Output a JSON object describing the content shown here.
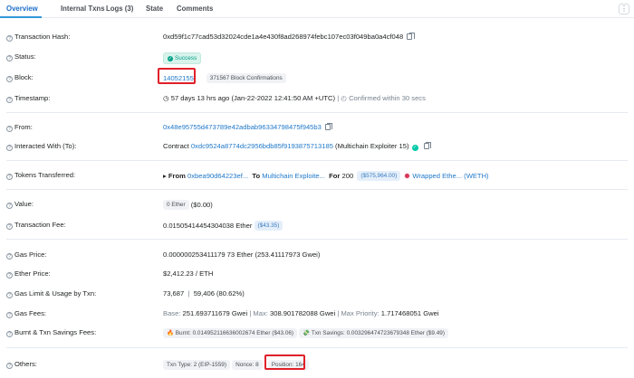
{
  "tabs": [
    "Overview",
    "Internal Txns",
    "Logs (3)",
    "State",
    "Comments"
  ],
  "kebab_glyph": "⋮",
  "labels": {
    "tx_hash": "Transaction Hash:",
    "status": "Status:",
    "block": "Block:",
    "timestamp": "Timestamp:",
    "from": "From:",
    "interacted": "Interacted With (To):",
    "tokens": "Tokens Transferred:",
    "value": "Value:",
    "fee": "Transaction Fee:",
    "gas_price": "Gas Price:",
    "ether_price": "Ether Price:",
    "gas_limit": "Gas Limit & Usage by Txn:",
    "gas_fees": "Gas Fees:",
    "burnt": "Burnt & Txn Savings Fees:",
    "others": "Others:"
  },
  "tx_hash": "0xd59f1c77cad53d32024cde1a4e430f8ad268974febc107ec03f049ba0a4cf048",
  "status": "Success",
  "block": {
    "number": "14052155",
    "confirmations": "371567 Block Confirmations"
  },
  "timestamp": {
    "text": "57 days 13 hrs ago (Jan-22-2022 12:41:50 AM +UTC)",
    "separator": "|",
    "confirmed": "Confirmed within 30 secs"
  },
  "from": "0x48e95755d473789e42adbab96334798475f945b3",
  "interacted": {
    "prefix": "Contract",
    "address": "0xdc9524a8774dc2956bdb85f9193875713185",
    "name": "(Multichain Exploiter 15)"
  },
  "tokens": {
    "from_label": "From",
    "from_addr": "0xbea90d64223ef...",
    "to_label": "To",
    "to_addr": "Multichain Exploite...",
    "for_label": "For",
    "amount": "200",
    "usd": "($575,964.00)",
    "token": "Wrapped Ethe... (WETH)"
  },
  "value": {
    "amount": "0 Ether",
    "usd": "($0.00)"
  },
  "fee": {
    "amount": "0.01505414454304038 Ether",
    "usd": "($43.35)"
  },
  "gas_price": "0.000000253411179 73 Ether (253.41117973 Gwei)",
  "ether_price": "$2,412.23 / ETH",
  "gas_limit": {
    "limit": "73,687",
    "sep": "|",
    "usage": "59,406 (80.62%)"
  },
  "gas_fees": {
    "base_label": "Base:",
    "base": "251.693711679 Gwei",
    "max_label": "Max:",
    "max": "308.901782088 Gwei",
    "priority_label": "Max Priority:",
    "priority": "1.717468051 Gwei",
    "sep": "|"
  },
  "burnt": {
    "burnt_label": "Burnt:",
    "burnt": "0.014952116636002674 Ether ($43.06)",
    "savings_label": "Txn Savings:",
    "savings": "0.003296474723679348 Ether ($9.49)"
  },
  "others": {
    "txn_type": "Txn Type: 2 (EIP-1559)",
    "nonce": "Nonce: 8",
    "position": "Position: 164"
  },
  "colors": {
    "link": "#1f78c9",
    "success": "#00a186",
    "highlight": "#e0202a"
  }
}
